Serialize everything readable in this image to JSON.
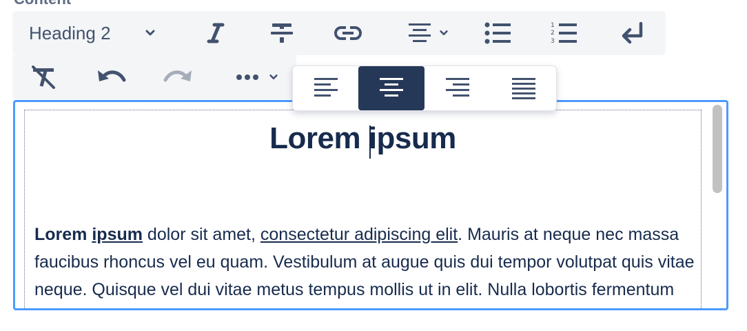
{
  "field": {
    "label": "Content"
  },
  "toolbar": {
    "heading_select": "Heading 2",
    "icons": {
      "italic": "italic-icon",
      "strike": "strikethrough-icon",
      "link": "link-icon",
      "align": "align-center-icon",
      "bullets": "bullet-list-icon",
      "numbered": "numbered-list-icon",
      "hard_break": "hard-break-icon",
      "clear_format": "clear-formatting-icon",
      "undo": "undo-icon",
      "redo": "redo-icon",
      "more": "more-icon"
    }
  },
  "align_menu": {
    "options": [
      "left",
      "center",
      "right",
      "justify"
    ],
    "active": "center"
  },
  "editor": {
    "heading_left": "Lorem",
    "heading_right": "ipsum",
    "para_bold_1": "Lorem",
    "para_bold_2": "ipsum",
    "para_text_1": " dolor sit amet, ",
    "para_link": "consectetur adipiscing elit",
    "para_text_2": ". Mauris at neque nec massa faucibus rhoncus vel eu quam. Vestibulum at augue quis dui tempor volutpat quis vitae neque. Quisque vel dui vitae metus tempus mollis ut in elit. Nulla lobortis fermentum consectetur. Ut quam sem"
  },
  "colors": {
    "accent": "#4c9aff",
    "text": "#172b4d",
    "toolbar_bg": "#f4f5f7",
    "active_bg": "#253858"
  }
}
